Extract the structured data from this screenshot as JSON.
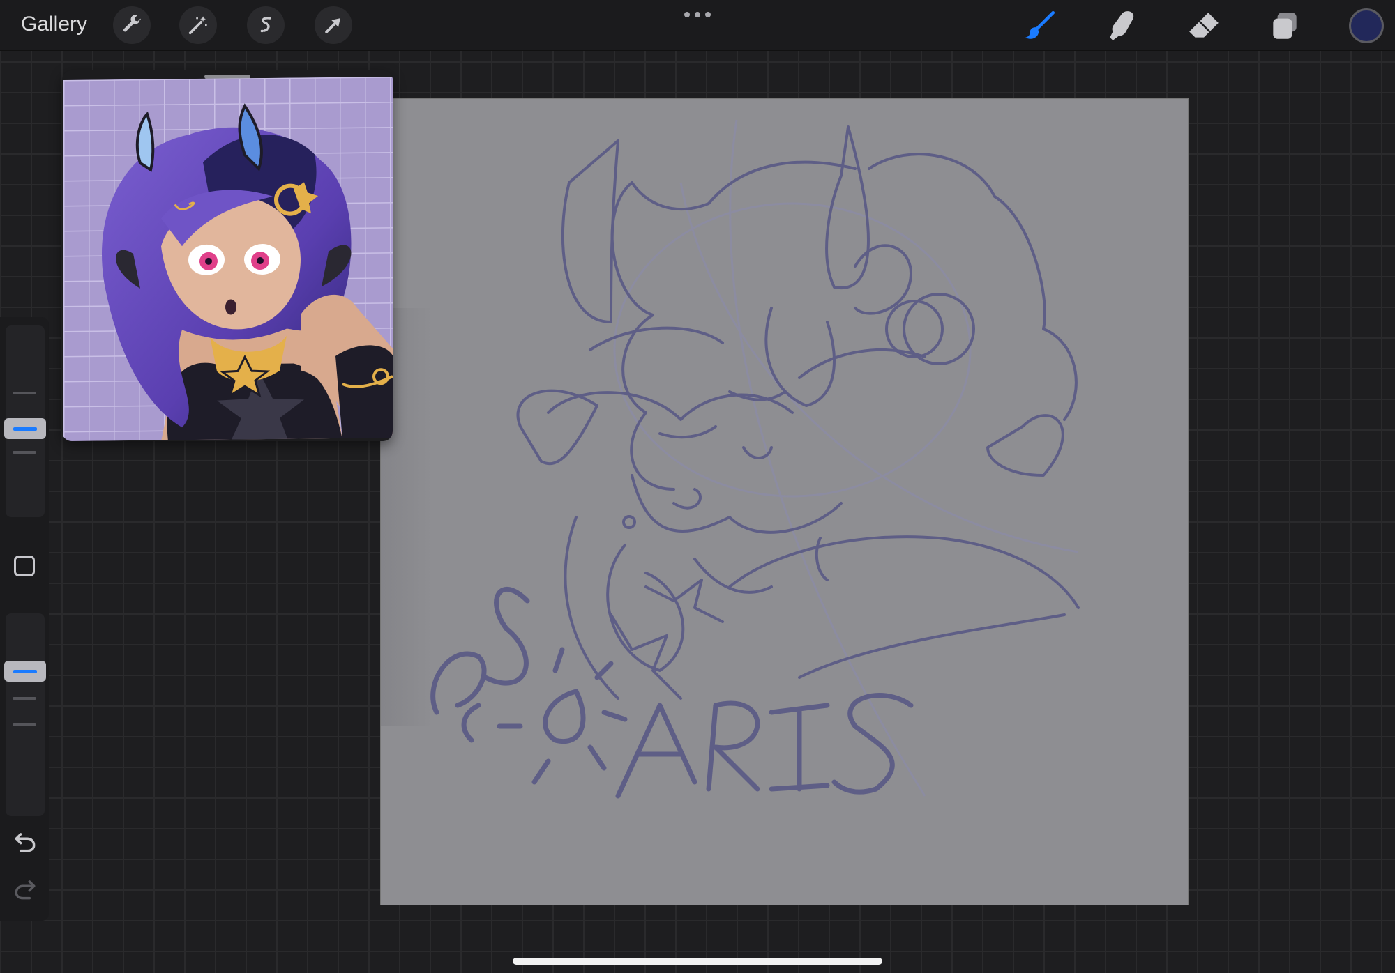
{
  "topbar": {
    "gallery_label": "Gallery",
    "left_tools": [
      {
        "name": "actions",
        "icon": "wrench-icon"
      },
      {
        "name": "adjustments",
        "icon": "magic-wand-icon"
      },
      {
        "name": "selection",
        "icon": "selection-s-icon"
      },
      {
        "name": "transform",
        "icon": "arrow-cursor-icon"
      }
    ],
    "more_icon": "ellipsis-icon",
    "right_tools": [
      {
        "name": "brush",
        "icon": "brush-icon",
        "active": true,
        "color": "#1a7bff"
      },
      {
        "name": "smudge",
        "icon": "smudge-finger-icon",
        "active": false
      },
      {
        "name": "eraser",
        "icon": "eraser-icon",
        "active": false
      },
      {
        "name": "layers",
        "icon": "layers-icon",
        "active": false
      }
    ],
    "current_color": "#22285a"
  },
  "sidebar": {
    "brush_size_slider": {
      "icon": "slider-thumb-icon",
      "accent": "#1a7bff"
    },
    "modify_button": {
      "icon": "square-modify-icon"
    },
    "opacity_slider": {
      "icon": "slider-thumb-icon",
      "accent": "#1a7bff"
    },
    "undo_icon": "undo-arrow-icon",
    "redo_icon": "redo-arrow-icon"
  },
  "reference_panel": {
    "image_desc_icon": "reference-image-icon",
    "background": "#a99bcf"
  },
  "canvas": {
    "background": "#8e8e92",
    "sketch_stroke": "#5e5e86",
    "lettering_icon": "sketch-signature-icon"
  }
}
